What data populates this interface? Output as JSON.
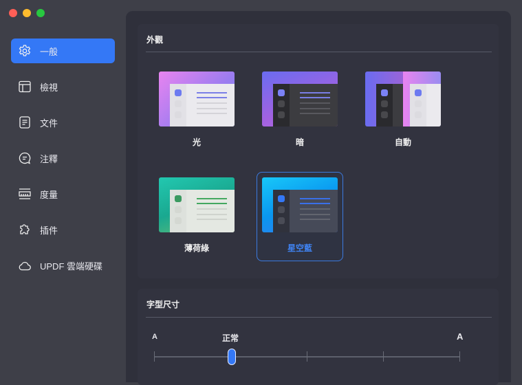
{
  "window": {
    "controls": [
      {
        "name": "close",
        "color": "#ff5f57"
      },
      {
        "name": "minimize",
        "color": "#febc2e"
      },
      {
        "name": "zoom",
        "color": "#28c840"
      }
    ]
  },
  "sidebar": {
    "items": [
      {
        "label": "一般",
        "icon": "gear-icon",
        "active": true
      },
      {
        "label": "檢視",
        "icon": "layout-icon"
      },
      {
        "label": "文件",
        "icon": "document-icon"
      },
      {
        "label": "注釋",
        "icon": "comment-icon"
      },
      {
        "label": "度量",
        "icon": "ruler-icon"
      },
      {
        "label": "插件",
        "icon": "puzzle-icon"
      },
      {
        "label": "UPDF 雲端硬碟",
        "icon": "cloud-icon"
      }
    ]
  },
  "appearance": {
    "title": "外觀",
    "themes": [
      {
        "label": "光"
      },
      {
        "label": "暗"
      },
      {
        "label": "自動"
      },
      {
        "label": "薄荷綠"
      },
      {
        "label": "星空藍",
        "selected": true
      }
    ]
  },
  "font_size": {
    "title": "字型尺寸",
    "min_label": "A",
    "current_label": "正常",
    "max_label": "A",
    "steps": 5,
    "current_step": 2
  },
  "colors": {
    "accent": "#3478f6"
  }
}
